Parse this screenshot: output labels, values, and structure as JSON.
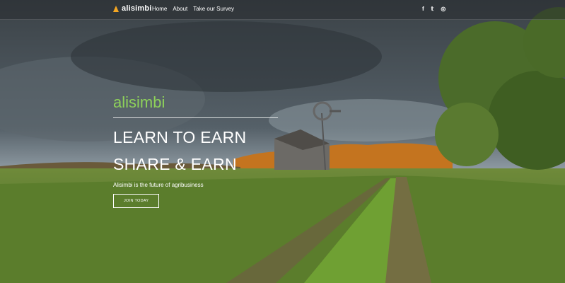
{
  "nav": {
    "logo_text": "alisimbi",
    "links": [
      "Home",
      "About",
      "Take our Survey"
    ],
    "social": [
      "f",
      "𝕥",
      "◎"
    ]
  },
  "hero": {
    "brand": "alisimbi",
    "headline_1": "LEARN TO EARN",
    "headline_2": "SHARE & EARN",
    "tagline": "Alisimbi is the future of agribusiness",
    "cta_label": "JOIN TODAY"
  },
  "colors": {
    "brand_green": "#8ed15a",
    "logo_orange": "#f5a623"
  },
  "icons": [
    "logo-triangle-icon",
    "facebook-icon",
    "twitter-icon",
    "instagram-icon"
  ]
}
